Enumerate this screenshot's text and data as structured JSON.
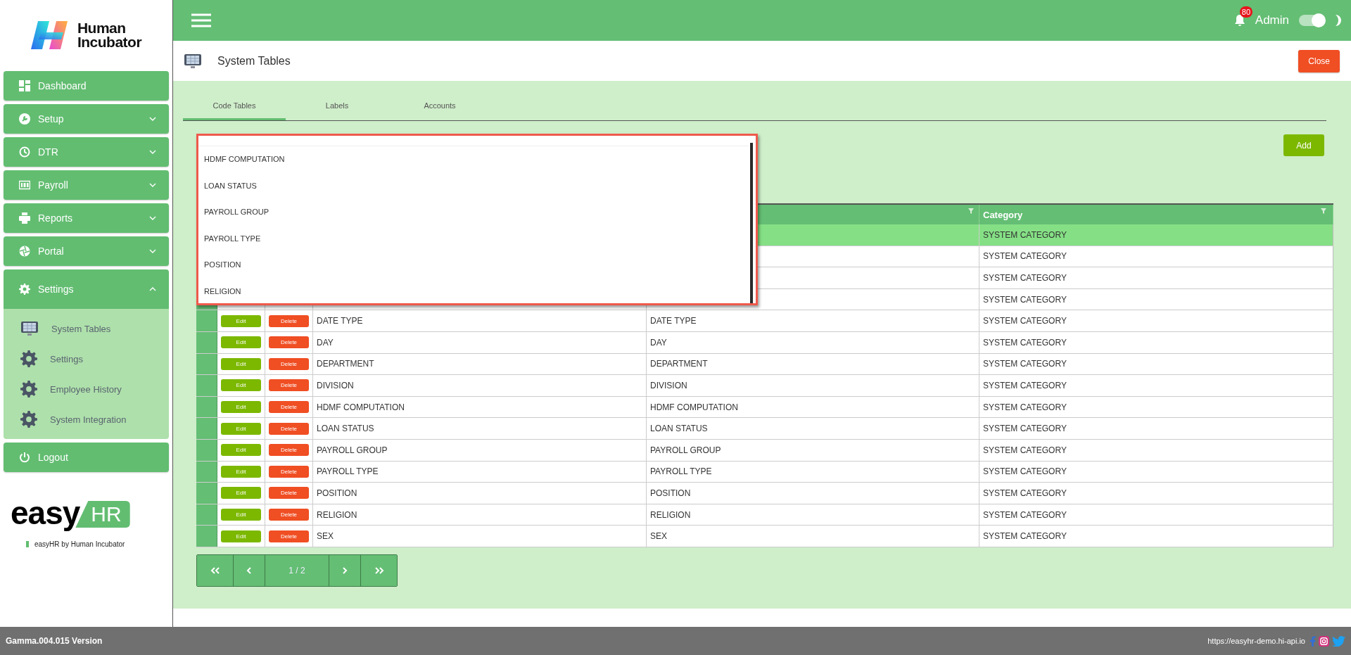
{
  "sidebar": {
    "logo": {
      "line1": "Human",
      "line2": "Incubator"
    },
    "items": [
      {
        "label": "Dashboard"
      },
      {
        "label": "Setup",
        "expanded": false
      },
      {
        "label": "DTR",
        "expanded": false
      },
      {
        "label": "Payroll",
        "expanded": false
      },
      {
        "label": "Reports",
        "expanded": false
      },
      {
        "label": "Portal",
        "expanded": false
      },
      {
        "label": "Settings",
        "expanded": true,
        "children": [
          {
            "label": "System Tables"
          },
          {
            "label": "Settings"
          },
          {
            "label": "Employee History"
          },
          {
            "label": "System Integration"
          }
        ]
      },
      {
        "label": "Logout"
      }
    ],
    "brand": {
      "word": "easy",
      "badge": "HR",
      "tagline": "easyHR by Human Incubator"
    }
  },
  "header": {
    "notifications": "80",
    "user": "Admin",
    "toggle_on": true
  },
  "page": {
    "title": "System Tables",
    "close": "Close"
  },
  "tabs": [
    {
      "label": "Code Tables",
      "selected": true
    },
    {
      "label": "Labels",
      "selected": false
    },
    {
      "label": "Accounts",
      "selected": false
    }
  ],
  "add": "Add",
  "dropdown": {
    "items": [
      "HDMF COMPUTATION",
      "LOAN STATUS",
      "PAYROLL GROUP",
      "PAYROLL TYPE",
      "POSITION",
      "RELIGION"
    ]
  },
  "table": {
    "columns": [
      {
        "label": "Category"
      }
    ],
    "rows": [
      {
        "category": "SYSTEM CATEGORY",
        "selected": true
      },
      {
        "category": "SYSTEM CATEGORY",
        "selected": false
      },
      {
        "category": "SYSTEM CATEGORY",
        "selected": false
      },
      {
        "category": "SYSTEM CATEGORY",
        "selected": false
      },
      {
        "edit": "Edit",
        "delete": "Delete",
        "name": "DATE TYPE",
        "description": "DATE TYPE",
        "category": "SYSTEM CATEGORY",
        "selected": false
      },
      {
        "edit": "Edit",
        "delete": "Delete",
        "name": "DAY",
        "description": "DAY",
        "category": "SYSTEM CATEGORY",
        "selected": false
      },
      {
        "edit": "Edit",
        "delete": "Delete",
        "name": "DEPARTMENT",
        "description": "DEPARTMENT",
        "category": "SYSTEM CATEGORY",
        "selected": false
      },
      {
        "edit": "Edit",
        "delete": "Delete",
        "name": "DIVISION",
        "description": "DIVISION",
        "category": "SYSTEM CATEGORY",
        "selected": false
      },
      {
        "edit": "Edit",
        "delete": "Delete",
        "name": "HDMF COMPUTATION",
        "description": "HDMF COMPUTATION",
        "category": "SYSTEM CATEGORY",
        "selected": false
      },
      {
        "edit": "Edit",
        "delete": "Delete",
        "name": "LOAN STATUS",
        "description": "LOAN STATUS",
        "category": "SYSTEM CATEGORY",
        "selected": false
      },
      {
        "edit": "Edit",
        "delete": "Delete",
        "name": "PAYROLL GROUP",
        "description": "PAYROLL GROUP",
        "category": "SYSTEM CATEGORY",
        "selected": false
      },
      {
        "edit": "Edit",
        "delete": "Delete",
        "name": "PAYROLL TYPE",
        "description": "PAYROLL TYPE",
        "category": "SYSTEM CATEGORY",
        "selected": false
      },
      {
        "edit": "Edit",
        "delete": "Delete",
        "name": "POSITION",
        "description": "POSITION",
        "category": "SYSTEM CATEGORY",
        "selected": false
      },
      {
        "edit": "Edit",
        "delete": "Delete",
        "name": "RELIGION",
        "description": "RELIGION",
        "category": "SYSTEM CATEGORY",
        "selected": false
      },
      {
        "edit": "Edit",
        "delete": "Delete",
        "name": "SEX",
        "description": "SEX",
        "category": "SYSTEM CATEGORY",
        "selected": false
      }
    ]
  },
  "pagination": {
    "page": "1 / 2"
  },
  "footer": {
    "version": "Gamma.004.015 Version",
    "url": "https://easyhr-demo.hi-api.io"
  }
}
